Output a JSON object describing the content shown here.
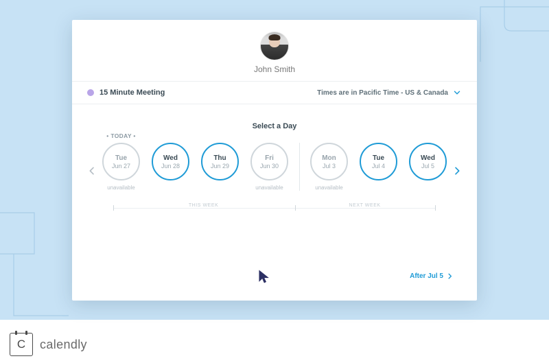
{
  "brand": {
    "name": "calendly",
    "icon_letter": "C"
  },
  "profile": {
    "name": "John Smith"
  },
  "event": {
    "color": "#b9a5e8",
    "name": "15 Minute Meeting"
  },
  "timezone": {
    "label": "Times are in Pacific Time - US & Canada",
    "chevron_color": "#1f9bd6"
  },
  "section_title": "Select a Day",
  "today_tag": "TODAY",
  "week_labels": {
    "this": "THIS WEEK",
    "next": "NEXT WEEK"
  },
  "unavailable_label": "unavailable",
  "after_link": {
    "label": "After Jul 5"
  },
  "days": {
    "this_week": [
      {
        "dow": "Tue",
        "date": "Jun 27",
        "available": false
      },
      {
        "dow": "Wed",
        "date": "Jun 28",
        "available": true
      },
      {
        "dow": "Thu",
        "date": "Jun 29",
        "available": true
      },
      {
        "dow": "Fri",
        "date": "Jun 30",
        "available": false
      }
    ],
    "next_week": [
      {
        "dow": "Mon",
        "date": "Jul 3",
        "available": false
      },
      {
        "dow": "Tue",
        "date": "Jul 4",
        "available": true
      },
      {
        "dow": "Wed",
        "date": "Jul 5",
        "available": true
      }
    ]
  },
  "colors": {
    "accent": "#1f9bd6",
    "muted": "#cfd6db"
  }
}
